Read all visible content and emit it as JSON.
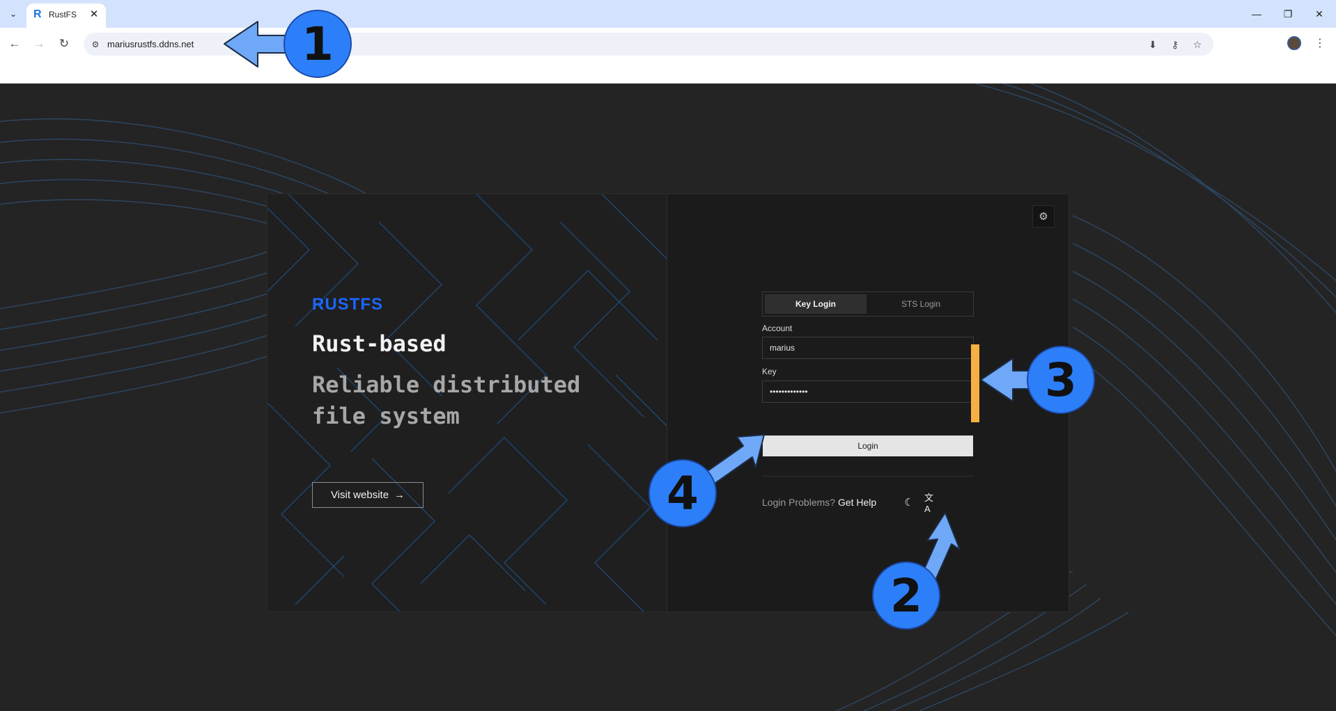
{
  "browser": {
    "tab_title": "RustFS",
    "tab_favicon": "R",
    "url": "mariusrustfs.ddns.net",
    "icons": {
      "tab_list": "chevron-down-icon",
      "close_tab": "close-icon",
      "minimize": "minimize-icon",
      "restore": "restore-icon",
      "close_window": "close-icon",
      "back": "back-arrow-icon",
      "forward": "forward-arrow-icon",
      "reload": "reload-icon",
      "site_info": "tune-icon",
      "install": "install-app-icon",
      "password": "key-icon",
      "bookmark": "star-icon",
      "menu": "kebab-menu-icon"
    }
  },
  "hero": {
    "logo_text": "RUSTFS",
    "headline": "Rust-based",
    "tagline": "Reliable distributed file system",
    "visit_label": "Visit website",
    "visit_arrow": "→"
  },
  "login": {
    "tabs": [
      {
        "label": "Key Login",
        "active": true
      },
      {
        "label": "STS Login",
        "active": false
      }
    ],
    "account_label": "Account",
    "account_value": "marius",
    "key_label": "Key",
    "key_value": "•••••••••••••",
    "submit_label": "Login",
    "help_prefix": "Login Problems?",
    "help_link": "Get Help",
    "icons": {
      "settings": "gear-icon",
      "theme": "moon-icon",
      "language": "translate-icon"
    }
  },
  "annotations": {
    "steps": [
      "1",
      "2",
      "3",
      "4"
    ],
    "arrow_color": "#6ea8f7",
    "badge_color": "#2d7ff9",
    "bracket_color": "#f6b042"
  },
  "colors": {
    "brand": "#1b66ff",
    "page_bg": "#242424",
    "panel_bg": "#1b1b1b"
  }
}
